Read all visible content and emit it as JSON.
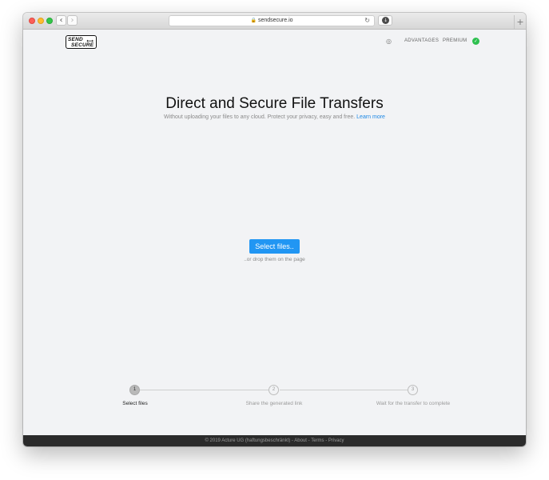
{
  "browser": {
    "url": "sendsecure.io",
    "back_icon": "‹",
    "forward_icon": "›",
    "lock_icon": "🔒",
    "reload_icon": "↻",
    "download_icon": "↓",
    "new_tab_icon": "+"
  },
  "header": {
    "logo_line1": "SEND",
    "logo_line2": "SECURE",
    "globe_icon": "◎",
    "nav_advantages": "ADVANTAGES",
    "nav_premium": "PREMIUM",
    "check_icon": "✓"
  },
  "hero": {
    "title": "Direct and Secure File Transfers",
    "subtitle": "Without uploading your files to any cloud. Protect your privacy, easy and free.",
    "learn_more": "Learn more"
  },
  "upload": {
    "button_label": "Select files..",
    "drop_hint": "..or drop them on the page"
  },
  "steps": [
    {
      "number": "1",
      "label": "Select files"
    },
    {
      "number": "2",
      "label": "Share the generated link"
    },
    {
      "number": "3",
      "label": "Wait for the transfer to complete"
    }
  ],
  "footer": {
    "copyright": "© 2019 Acture UG (haftungsbeschränkt)",
    "sep": " - ",
    "about": "About",
    "terms": "Terms",
    "privacy": "Privacy"
  },
  "colors": {
    "accent": "#2196f3",
    "success": "#2ec04f",
    "footer_bg": "#2b2b2b",
    "page_bg": "#f2f3f5"
  }
}
